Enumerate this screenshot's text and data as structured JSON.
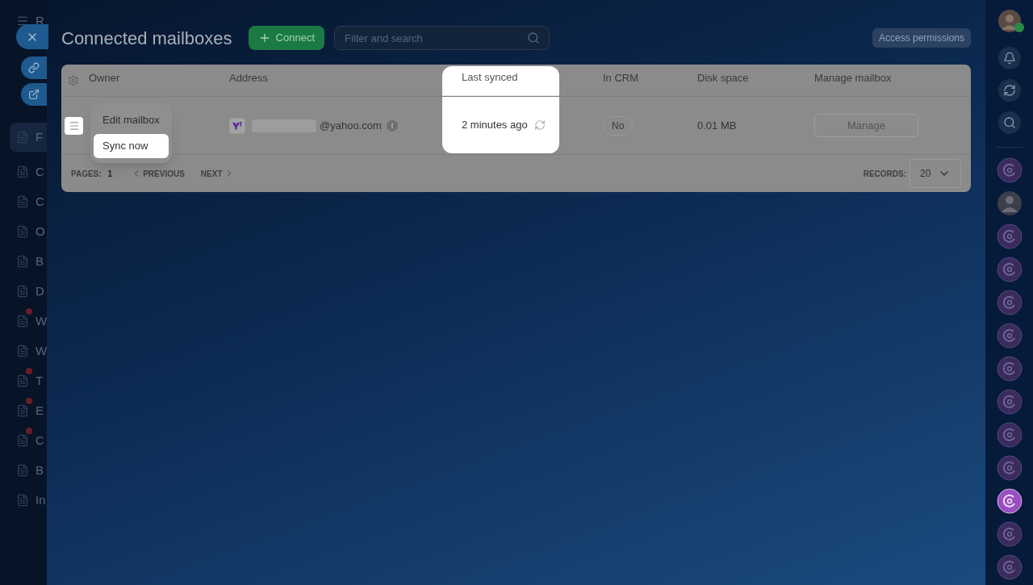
{
  "left_sidebar": {
    "title": "R",
    "items": [
      {
        "label": "F",
        "selected": true,
        "badge": false
      },
      {
        "label": "C",
        "selected": false,
        "badge": false
      },
      {
        "label": "C",
        "selected": false,
        "badge": false
      },
      {
        "label": "O",
        "selected": false,
        "badge": false
      },
      {
        "label": "B",
        "selected": false,
        "badge": false
      },
      {
        "label": "D",
        "selected": false,
        "badge": false
      },
      {
        "label": "W",
        "selected": false,
        "badge": true
      },
      {
        "label": "W",
        "selected": false,
        "badge": false
      },
      {
        "label": "T",
        "selected": false,
        "badge": true
      },
      {
        "label": "E",
        "selected": false,
        "badge": true
      },
      {
        "label": "C",
        "selected": false,
        "badge": true
      },
      {
        "label": "B",
        "selected": false,
        "badge": false
      },
      {
        "label": "In",
        "selected": false,
        "badge": false
      }
    ]
  },
  "header": {
    "title": "Connected mailboxes",
    "connect_button": "Connect",
    "search": {
      "placeholder": "Filter and search"
    },
    "access_button": "Access permissions"
  },
  "table": {
    "columns": [
      {
        "label": "Owner",
        "highlighted": false
      },
      {
        "label": "Address",
        "highlighted": false
      },
      {
        "label": "Last synced",
        "highlighted": true
      },
      {
        "label": "In CRM",
        "highlighted": false
      },
      {
        "label": "Disk space",
        "highlighted": false
      },
      {
        "label": "Manage mailbox",
        "highlighted": false
      }
    ],
    "rows": [
      {
        "address": "@yahoo.com",
        "last_synced": "2 minutes ago",
        "in_crm": "No",
        "disk_space": "0.01 MB",
        "manage": "Manage"
      }
    ]
  },
  "context_menu": {
    "items": [
      {
        "label": "Edit mailbox",
        "highlighted": false
      },
      {
        "label": "Sync now",
        "highlighted": true
      }
    ]
  },
  "pager": {
    "pages_label": "PAGES:",
    "page": "1",
    "previous": "PREVIOUS",
    "next": "NEXT",
    "records_label": "RECORDS:",
    "records": "20"
  },
  "right_bar": {
    "items": [
      {
        "kind": "app",
        "selected": false
      },
      {
        "kind": "avatar",
        "selected": false
      },
      {
        "kind": "app",
        "selected": false
      },
      {
        "kind": "app",
        "selected": false
      },
      {
        "kind": "app",
        "selected": false
      },
      {
        "kind": "app",
        "selected": false
      },
      {
        "kind": "app",
        "selected": false
      },
      {
        "kind": "app",
        "selected": false
      },
      {
        "kind": "app",
        "selected": false
      },
      {
        "kind": "app",
        "selected": false
      },
      {
        "kind": "app",
        "selected": true
      },
      {
        "kind": "app",
        "selected": false
      },
      {
        "kind": "app",
        "selected": false
      }
    ]
  }
}
